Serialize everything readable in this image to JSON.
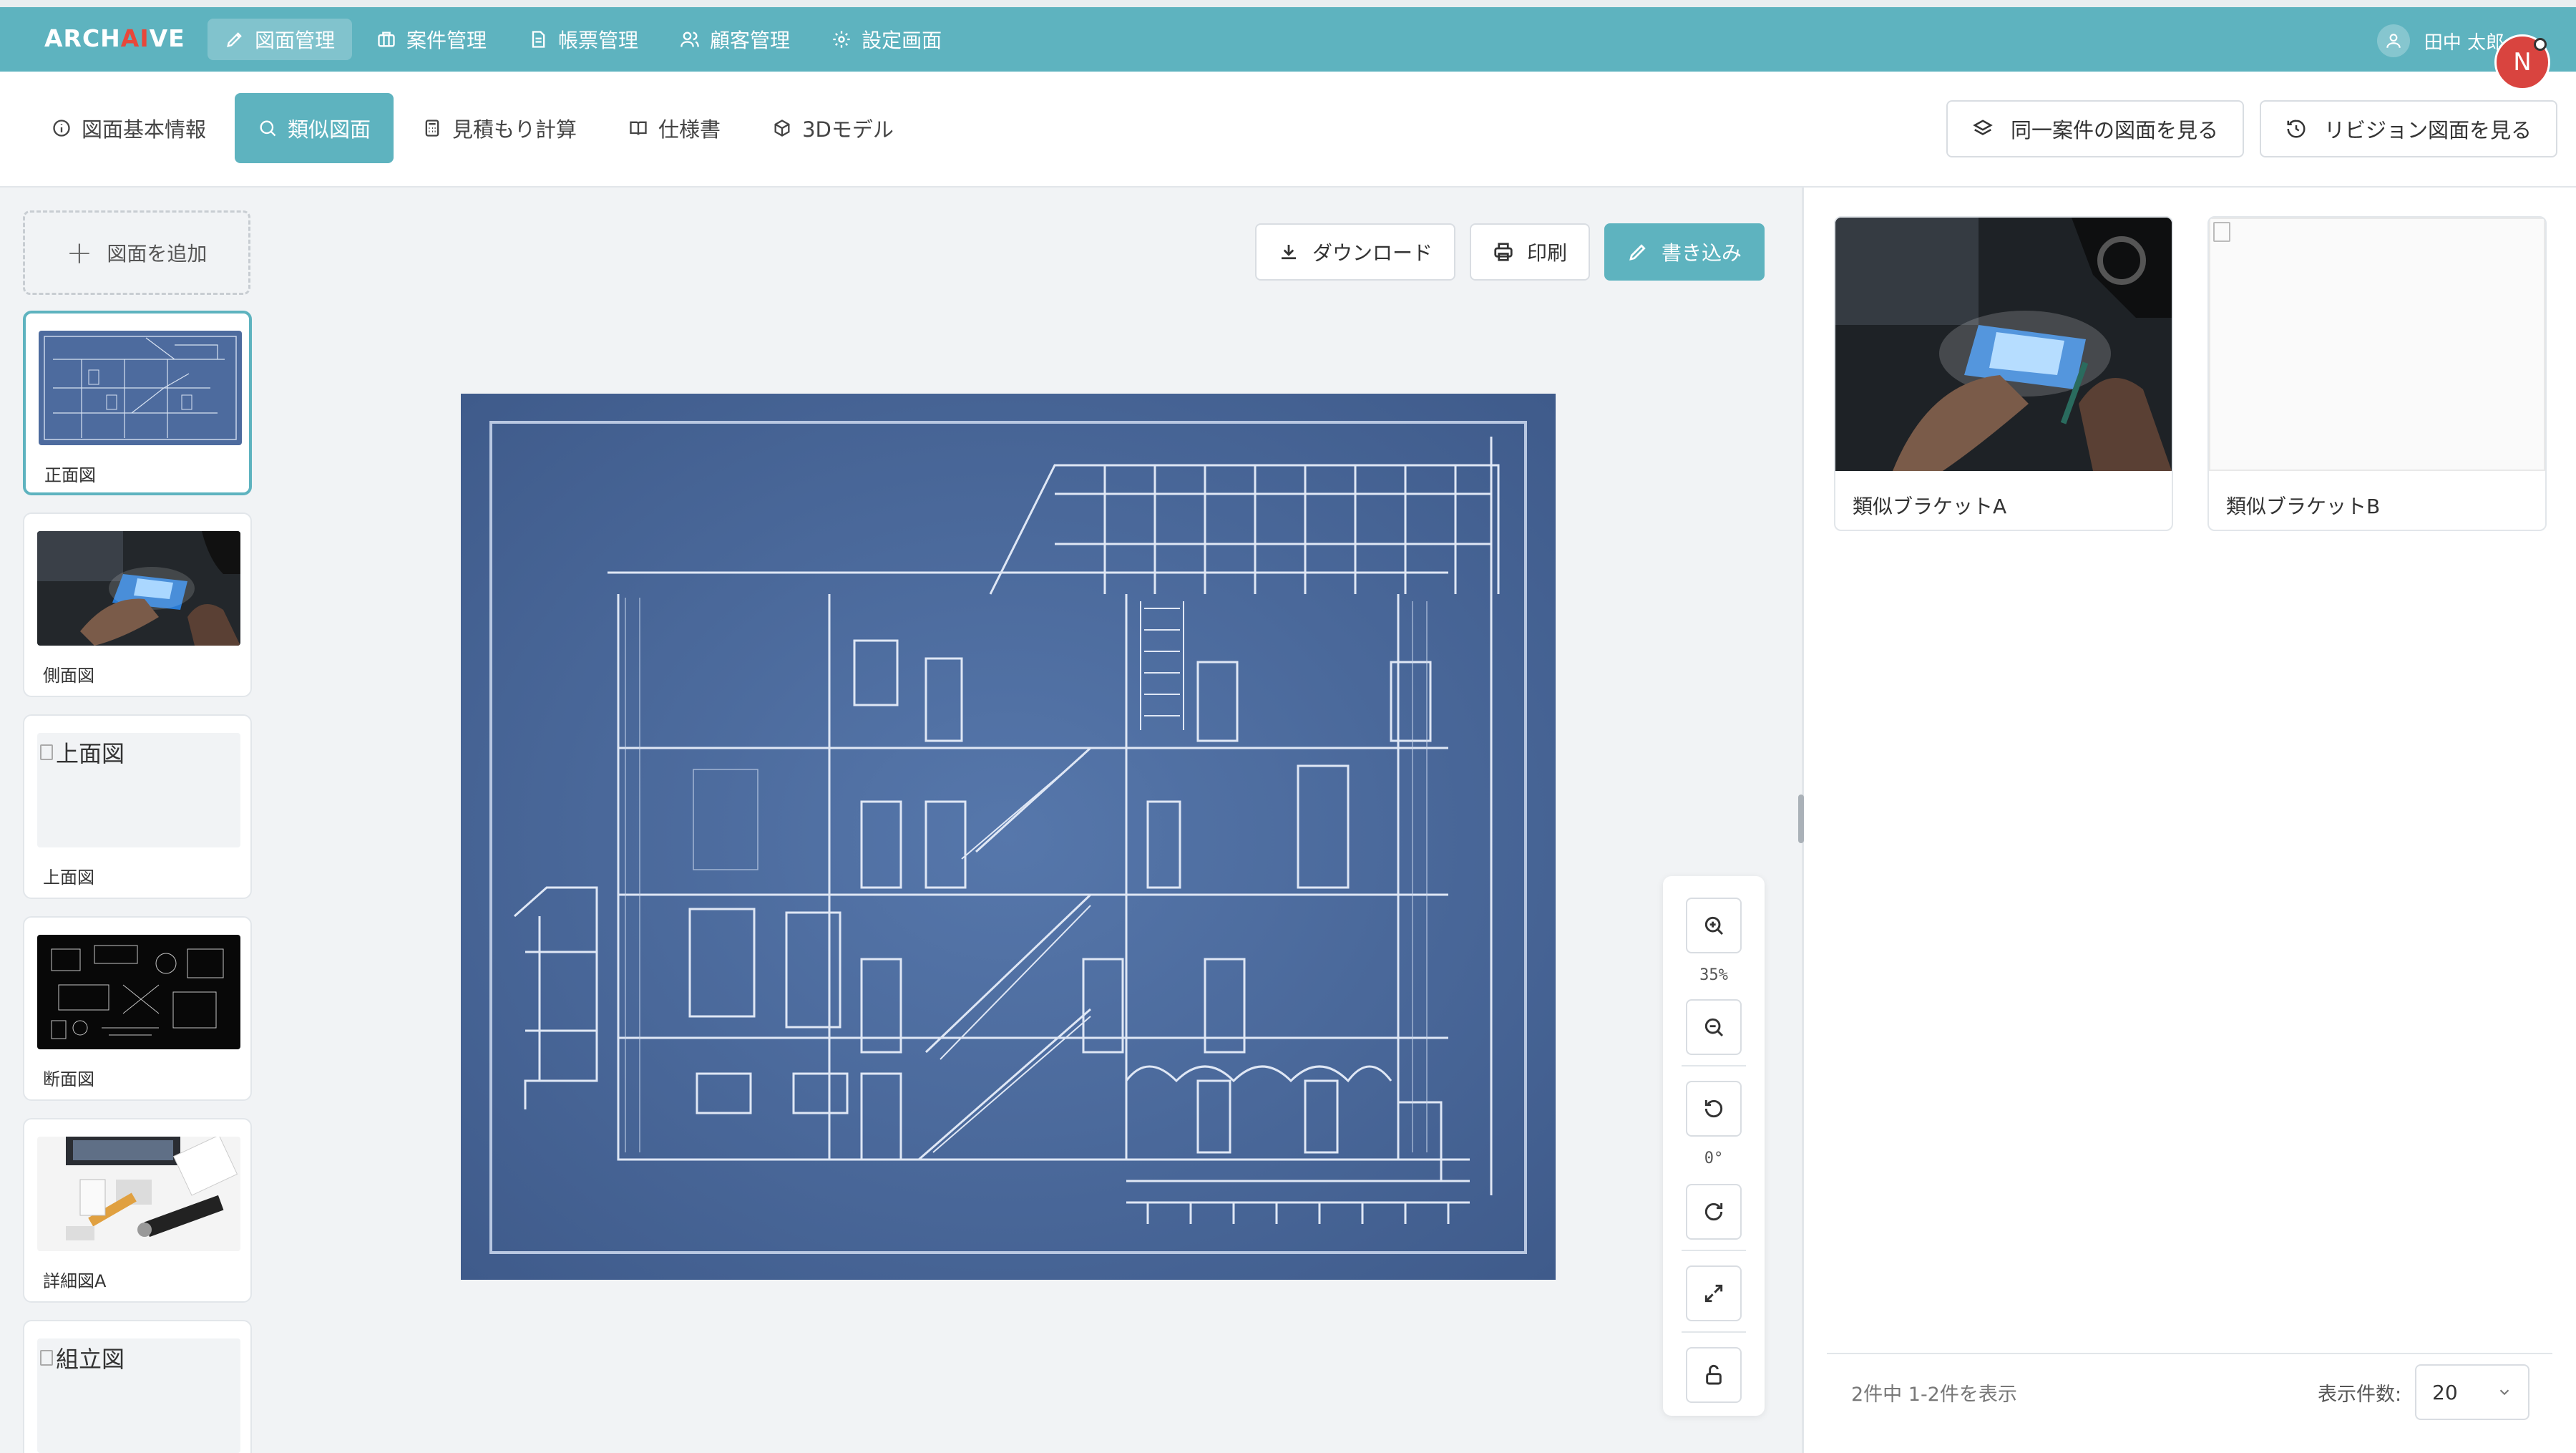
{
  "app": {
    "logo_prefix": "ARCH",
    "logo_ai": "AI",
    "logo_suffix": "VE"
  },
  "nav": [
    {
      "label": "図面管理",
      "icon": "pen-ruler-icon",
      "active": true
    },
    {
      "label": "案件管理",
      "icon": "briefcase-icon"
    },
    {
      "label": "帳票管理",
      "icon": "document-icon"
    },
    {
      "label": "顧客管理",
      "icon": "users-icon"
    },
    {
      "label": "設定画面",
      "icon": "gear-icon"
    }
  ],
  "user": {
    "name": "田中 太郎",
    "avatar_initial": "N"
  },
  "tabs": [
    {
      "label": "図面基本情報",
      "icon": "info-icon"
    },
    {
      "label": "類似図面",
      "icon": "search-icon",
      "active": true
    },
    {
      "label": "見積もり計算",
      "icon": "calculator-icon"
    },
    {
      "label": "仕様書",
      "icon": "book-icon"
    },
    {
      "label": "3Dモデル",
      "icon": "cube-icon"
    }
  ],
  "header_actions": {
    "same_project": "同一案件の図面を見る",
    "revision": "リビジョン図面を見る"
  },
  "sidebar": {
    "add_label": "図面を追加",
    "drawings": [
      {
        "label": "正面図",
        "type": "blueprint",
        "active": true
      },
      {
        "label": "側面図",
        "type": "photo"
      },
      {
        "label": "上面図",
        "type": "broken",
        "alt": "上面図"
      },
      {
        "label": "断面図",
        "type": "dark"
      },
      {
        "label": "詳細図A",
        "type": "desk"
      },
      {
        "label": "",
        "type": "broken",
        "alt": "組立図"
      }
    ]
  },
  "toolbar": {
    "download": "ダウンロード",
    "print": "印刷",
    "write": "書き込み"
  },
  "viewer": {
    "zoom": "35%",
    "rotation": "0°"
  },
  "similar": {
    "items": [
      {
        "label": "類似ブラケットA",
        "type": "photo"
      },
      {
        "label": "類似ブラケットB",
        "type": "broken"
      }
    ],
    "count_text": "2件中 1-2件を表示",
    "page_size_label": "表示件数:",
    "page_size": "20"
  },
  "colors": {
    "accent": "#5eb3bf",
    "logo_ai": "#e8473a",
    "avatar": "#d9443f",
    "blueprint": "#4d6b9e"
  }
}
